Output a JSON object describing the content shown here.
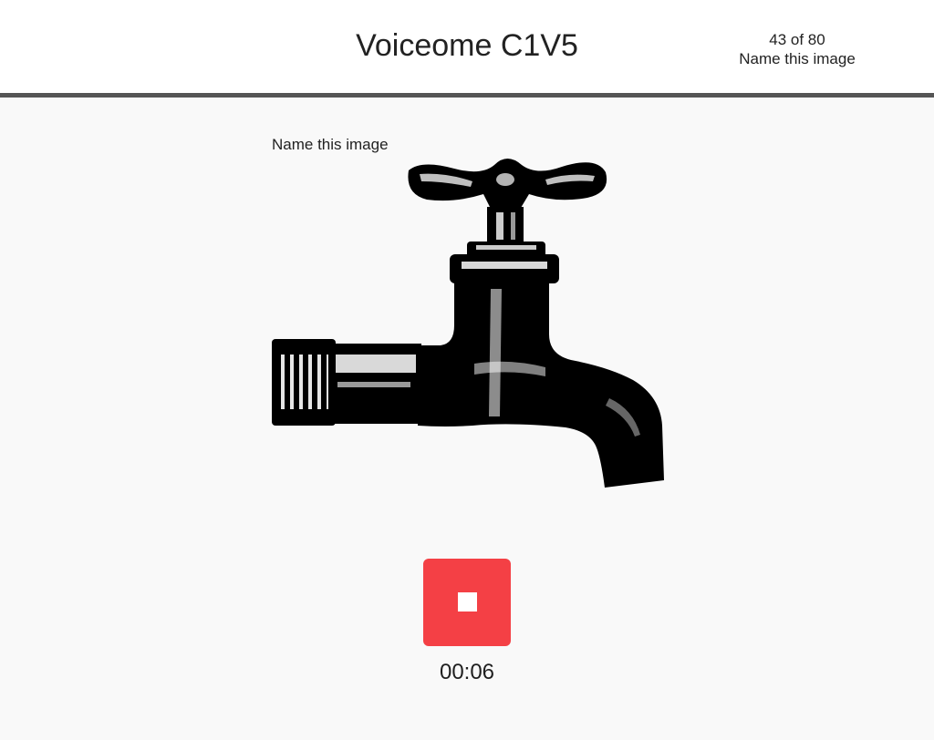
{
  "header": {
    "title": "Voiceome C1V5",
    "progress": "43 of 80",
    "task_name": "Name this image"
  },
  "task": {
    "prompt": "Name this image",
    "image_icon": "faucet-illustration"
  },
  "recorder": {
    "button_icon": "stop-icon",
    "button_color": "#f44045",
    "elapsed": "00:06"
  },
  "colors": {
    "header_bg": "#ffffff",
    "header_border": "#555555",
    "page_bg": "#f9f9f9"
  }
}
